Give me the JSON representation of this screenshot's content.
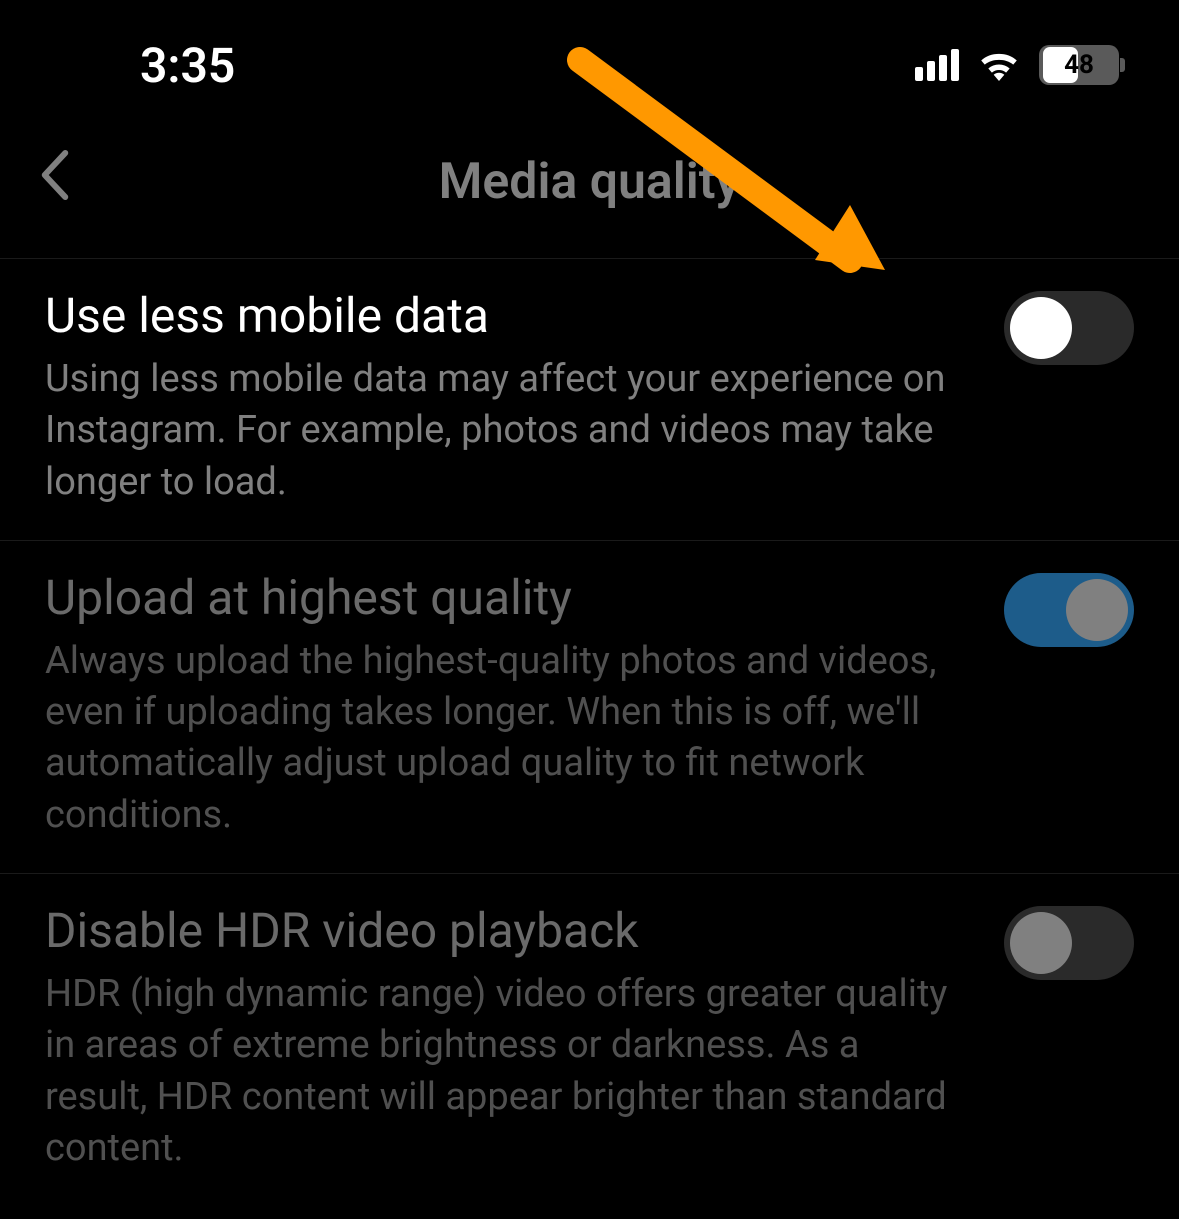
{
  "status_bar": {
    "time": "3:35",
    "battery_percent": "48"
  },
  "header": {
    "title": "Media quality"
  },
  "settings": [
    {
      "title": "Use less mobile data",
      "description": "Using less mobile data may affect your experience on Instagram. For example, photos and videos may take longer to load.",
      "toggle_state": "off",
      "highlighted": true
    },
    {
      "title": "Upload at highest quality",
      "description": "Always upload the highest-quality photos and videos, even if uploading takes longer. When this is off, we'll automatically adjust upload quality to fit network conditions.",
      "toggle_state": "on",
      "highlighted": false
    },
    {
      "title": "Disable HDR video playback",
      "description": "HDR (high dynamic range) video offers greater quality in areas of extreme brightness or darkness. As a result, HDR content will appear brighter than standard content.",
      "toggle_state": "off",
      "highlighted": false
    }
  ],
  "annotation": {
    "arrow_color": "#ff9800"
  }
}
